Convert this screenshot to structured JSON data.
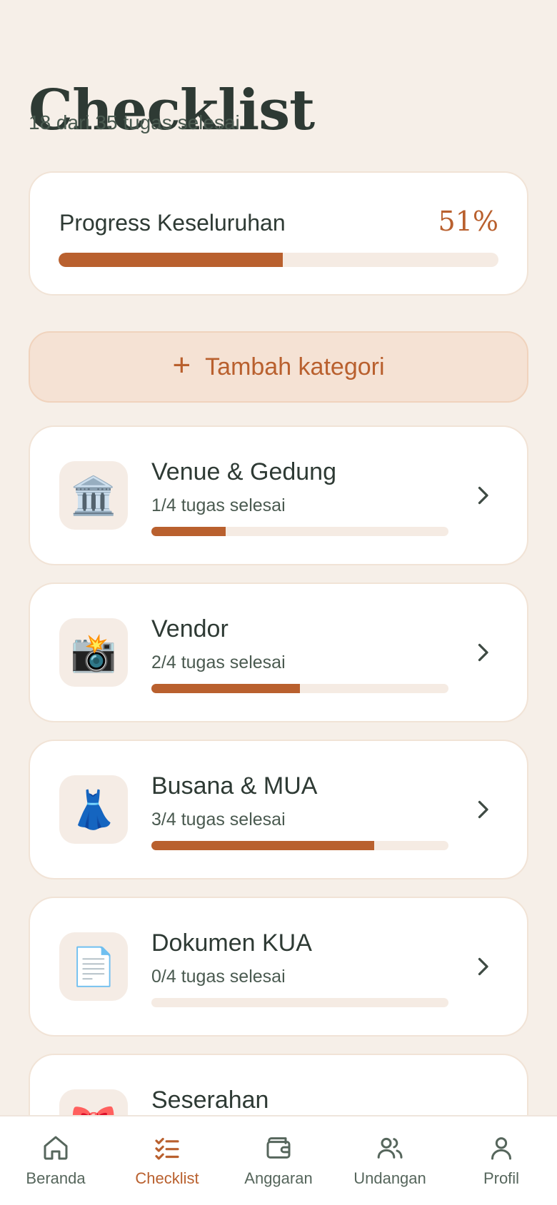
{
  "header": {
    "title": "Checklist",
    "subtitle": "18 dari 35 tugas selesai"
  },
  "overall": {
    "label": "Progress Keseluruhan",
    "percent_text": "51%",
    "fraction": 0.51
  },
  "add_category": {
    "label": "Tambah kategori",
    "plus_glyph": "+"
  },
  "categories": [
    {
      "name": "Venue & Gedung",
      "status": "1/4 tugas selesai",
      "fraction": 0.25,
      "icon": "🏛️",
      "icon_name": "building-icon"
    },
    {
      "name": "Vendor",
      "status": "2/4 tugas selesai",
      "fraction": 0.5,
      "icon": "📸",
      "icon_name": "camera-icon"
    },
    {
      "name": "Busana & MUA",
      "status": "3/4 tugas selesai",
      "fraction": 0.75,
      "icon": "👗",
      "icon_name": "dress-icon"
    },
    {
      "name": "Dokumen KUA",
      "status": "0/4 tugas selesai",
      "fraction": 0,
      "icon": "📄",
      "icon_name": "document-icon"
    },
    {
      "name": "Seserahan",
      "status": "",
      "fraction": 0,
      "icon": "🎀",
      "icon_name": "ribbon-icon"
    }
  ],
  "nav": {
    "items": [
      {
        "label": "Beranda",
        "icon": "home-icon"
      },
      {
        "label": "Checklist",
        "icon": "checklist-icon",
        "active": true
      },
      {
        "label": "Anggaran",
        "icon": "wallet-icon"
      },
      {
        "label": "Undangan",
        "icon": "users-icon"
      },
      {
        "label": "Profil",
        "icon": "user-icon"
      }
    ]
  },
  "colors": {
    "background": "#f6efe8",
    "accent": "#b9602e",
    "card": "#ffffff",
    "track": "#f5ebe3",
    "text": "#2e3a34"
  }
}
